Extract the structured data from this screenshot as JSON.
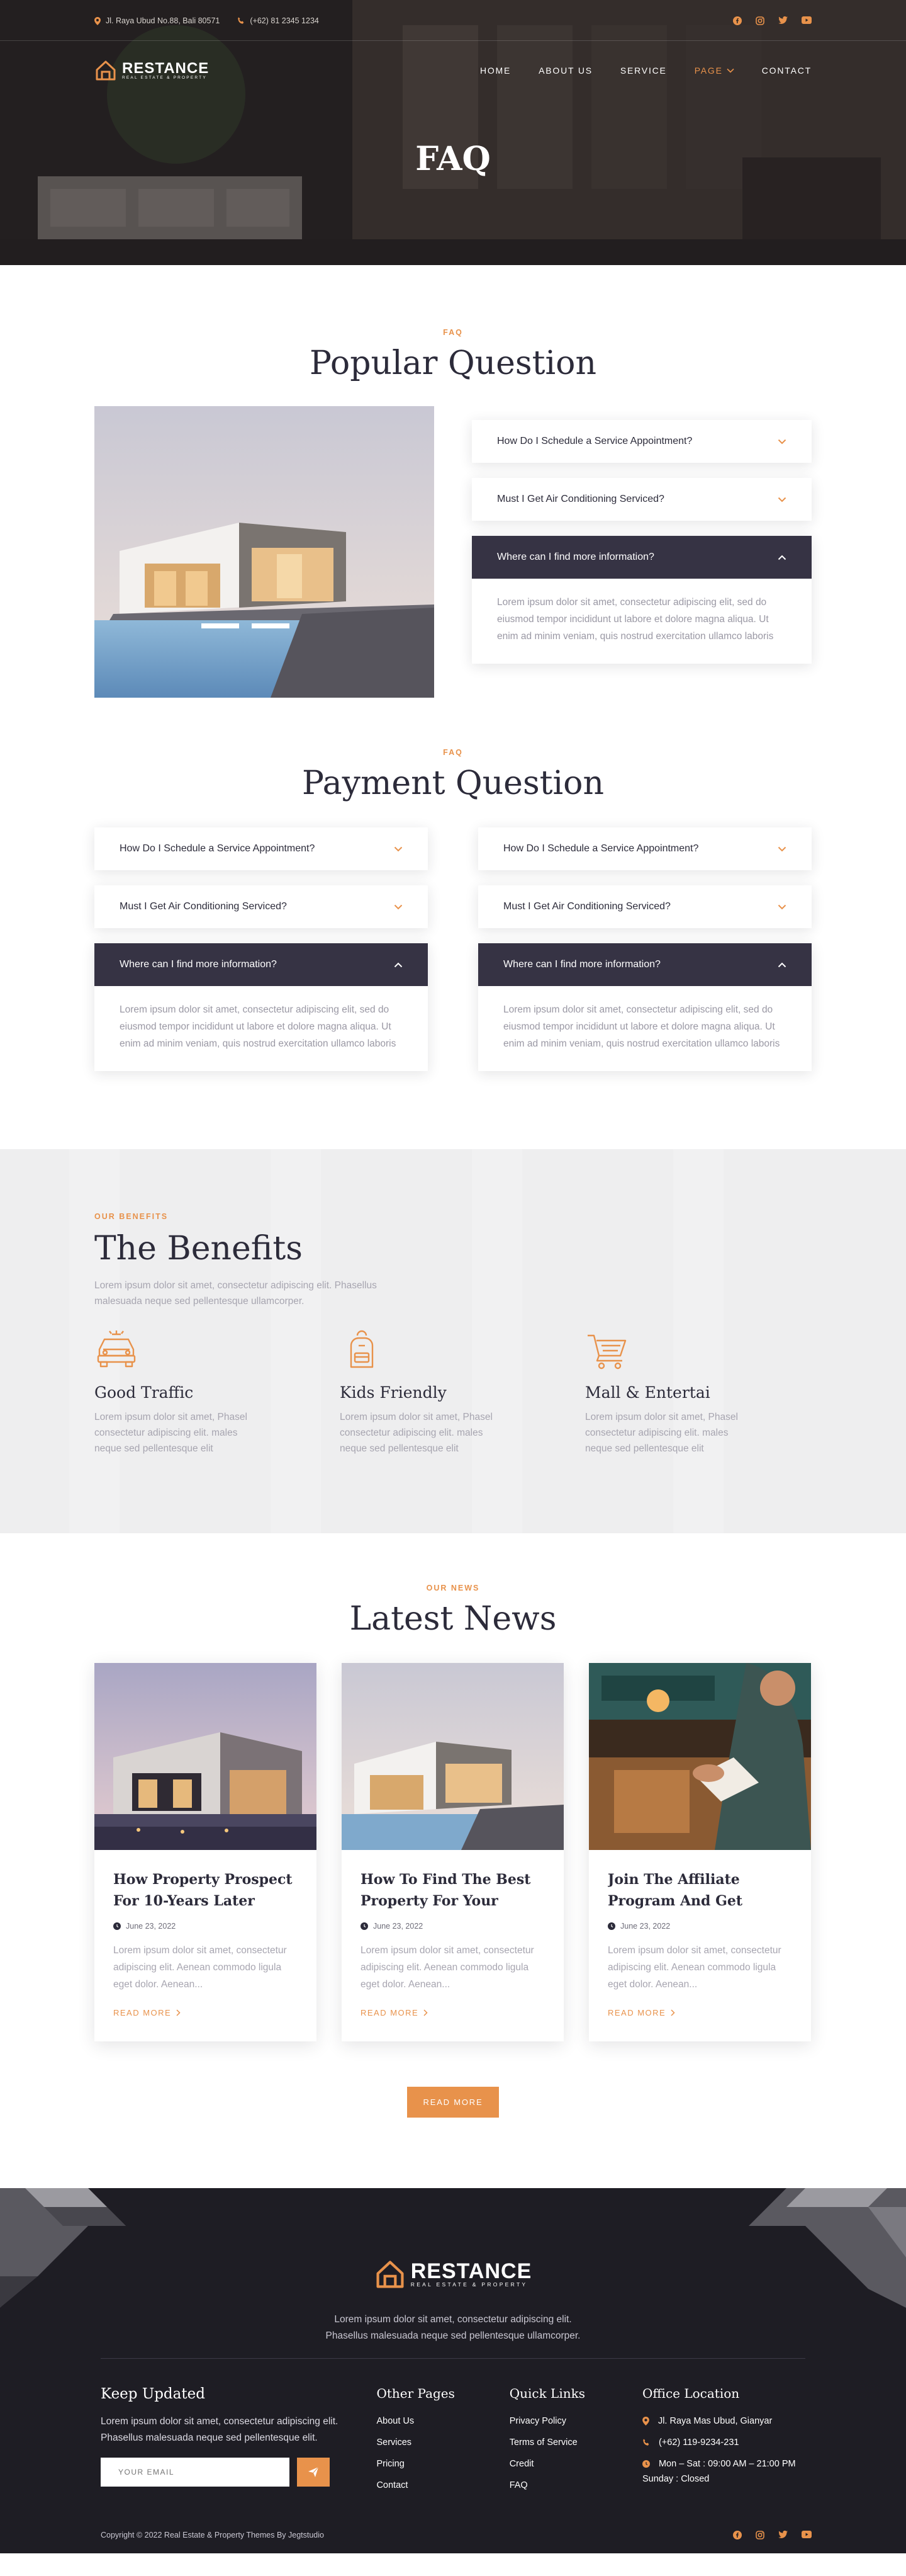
{
  "topbar": {
    "address": "Jl. Raya Ubud No.88, Bali 80571",
    "phone": "(+62) 81 2345 1234"
  },
  "brand": {
    "name": "RESTANCE",
    "tagline": "REAL ESTATE & PROPERTY"
  },
  "nav": {
    "items": [
      "HOME",
      "ABOUT US",
      "SERVICE",
      "PAGE",
      "CONTACT"
    ],
    "active": "PAGE"
  },
  "hero": {
    "title": "FAQ"
  },
  "faq_popular": {
    "kicker": "FAQ",
    "title": "Popular Question",
    "items": [
      {
        "q": "How Do I Schedule a Service Appointment?",
        "open": false
      },
      {
        "q": "Must I Get Air Conditioning Serviced?",
        "open": false
      },
      {
        "q": "Where can I find more information?",
        "open": true,
        "a": "Lorem ipsum dolor sit amet, consectetur adipiscing elit, sed do eiusmod tempor incididunt ut labore et dolore magna aliqua. Ut enim ad minim veniam, quis nostrud exercitation ullamco laboris"
      }
    ]
  },
  "faq_payment": {
    "kicker": "FAQ",
    "title": "Payment Question",
    "left": [
      {
        "q": "How Do I Schedule a Service Appointment?"
      },
      {
        "q": "Must I Get Air Conditioning Serviced?"
      },
      {
        "q": "Where can I find more information?",
        "a": "Lorem ipsum dolor sit amet, consectetur adipiscing elit, sed do eiusmod tempor incididunt ut labore et dolore magna aliqua. Ut enim ad minim veniam, quis nostrud exercitation ullamco laboris"
      }
    ],
    "right": [
      {
        "q": "How Do I Schedule a Service Appointment?"
      },
      {
        "q": "Must I Get Air Conditioning Serviced?"
      },
      {
        "q": "Where can I find more information?",
        "a": "Lorem ipsum dolor sit amet, consectetur adipiscing elit, sed do eiusmod tempor incididunt ut labore et dolore magna aliqua. Ut enim ad minim veniam, quis nostrud exercitation ullamco laboris"
      }
    ]
  },
  "benefits": {
    "kicker": "OUR BENEFITS",
    "title": "The Benefits",
    "desc": "Lorem ipsum dolor sit amet, consectetur adipiscing elit. Phasellus malesuada neque sed pellentesque ullamcorper.",
    "cards": [
      {
        "icon": "car-icon",
        "title": "Good Traffic",
        "text": "Lorem ipsum dolor sit amet, Phasel consectetur adipiscing elit. males neque sed pellentesque elit"
      },
      {
        "icon": "backpack-icon",
        "title": "Kids Friendly",
        "text": "Lorem ipsum dolor sit amet, Phasel consectetur adipiscing elit. males neque sed pellentesque elit"
      },
      {
        "icon": "cart-icon",
        "title": "Mall & Entertai",
        "text": "Lorem ipsum dolor sit amet, Phasel consectetur adipiscing elit. males neque sed pellentesque elit"
      }
    ]
  },
  "news": {
    "kicker": "OUR NEWS",
    "title": "Latest News",
    "read_label": "READ MORE",
    "button": "READ MORE",
    "posts": [
      {
        "title": "How Property Prospect For 10-Years Later",
        "date": "June 23, 2022",
        "excerpt": "Lorem ipsum dolor sit amet, consectetur adipiscing elit. Aenean commodo ligula eget dolor. Aenean..."
      },
      {
        "title": "How To Find The Best Property For Your",
        "date": "June 23, 2022",
        "excerpt": "Lorem ipsum dolor sit amet, consectetur adipiscing elit. Aenean commodo ligula eget dolor. Aenean..."
      },
      {
        "title": "Join The Affiliate Program And Get Benefit",
        "date": "June 23, 2022",
        "excerpt": "Lorem ipsum dolor sit amet, consectetur adipiscing elit. Aenean commodo ligula eget dolor. Aenean..."
      }
    ]
  },
  "footer": {
    "tagline": "Lorem ipsum dolor sit amet, consectetur adipiscing elit. Phasellus malesuada neque sed pellentesque ullamcorper.",
    "newsletter": {
      "title": "Keep Updated",
      "text": "Lorem ipsum dolor sit amet, consectetur adipiscing elit. Phasellus malesuada neque sed pellentesque elit.",
      "placeholder": "YOUR EMAIL"
    },
    "other_pages": {
      "title": "Other Pages",
      "links": [
        "About Us",
        "Services",
        "Pricing",
        "Contact"
      ]
    },
    "quick_links": {
      "title": "Quick Links",
      "links": [
        "Privacy Policy",
        "Terms of Service",
        "Credit",
        "FAQ"
      ]
    },
    "office": {
      "title": "Office Location",
      "address": "Jl. Raya Mas Ubud, Gianyar",
      "phone": "(+62) 119-9234-231",
      "hours": "Mon – Sat : 09:00 AM – 21:00 PM",
      "closed": "Sunday : Closed"
    },
    "copyright": "Copyright © 2022 Real Estate & Property Themes By Jegtstudio"
  },
  "colors": {
    "accent": "#e8924b",
    "dark": "#363344",
    "footer": "#1e1d24"
  }
}
